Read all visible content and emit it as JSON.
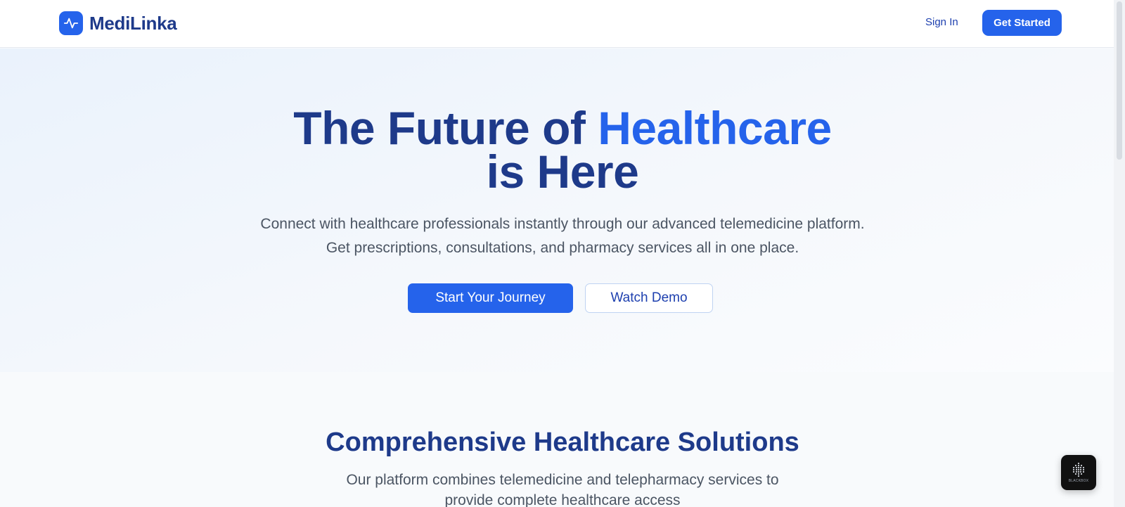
{
  "header": {
    "brand": "MediLinka",
    "sign_in": "Sign In",
    "get_started": "Get Started"
  },
  "hero": {
    "title_part1": "The Future of ",
    "title_accent": "Healthcare",
    "title_part2": "is Here",
    "subtitle_line1": "Connect with healthcare professionals instantly through our advanced telemedicine platform.",
    "subtitle_line2": "Get prescriptions, consultations, and pharmacy services all in one place.",
    "primary_cta": "Start Your Journey",
    "secondary_cta": "Watch Demo"
  },
  "solutions": {
    "title": "Comprehensive Healthcare Solutions",
    "subtitle_line1": "Our platform combines telemedicine and telepharmacy services to",
    "subtitle_line2": "provide complete healthcare access"
  },
  "widget": {
    "label": "BLACKBOX",
    "icon": "dot-matrix-icon"
  },
  "colors": {
    "brand_primary": "#2563eb",
    "brand_dark": "#1e3a8a",
    "text_muted": "#4b5563"
  }
}
